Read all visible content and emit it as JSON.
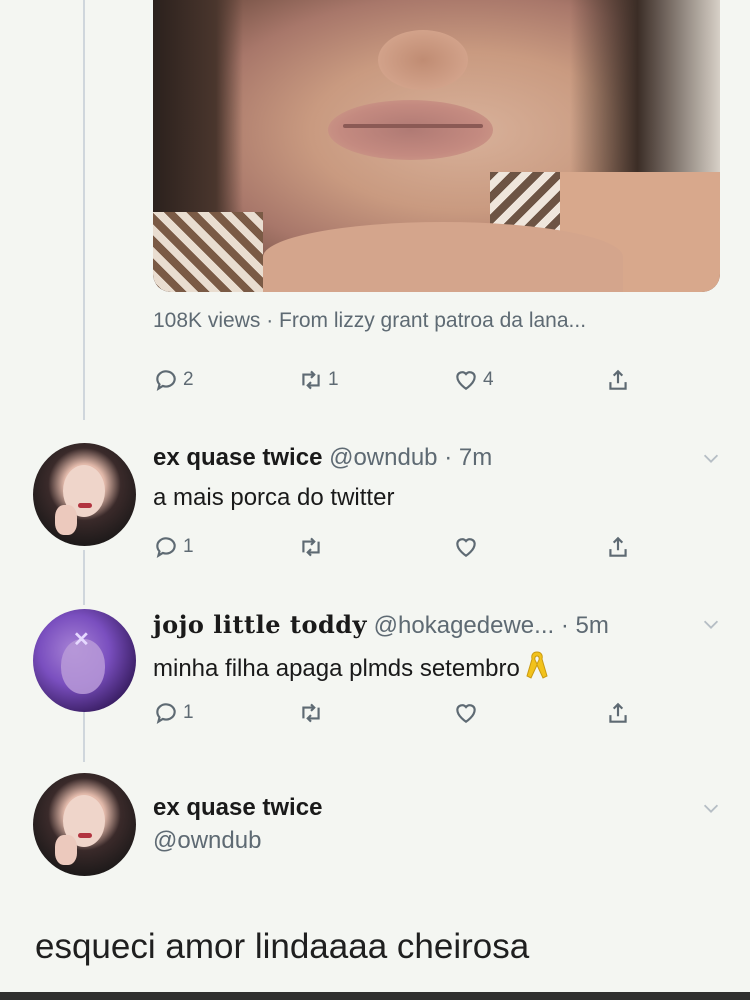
{
  "media_tweet": {
    "views_text": "108K views · From lizzy grant patroa da lana...",
    "actions": {
      "replies": "2",
      "retweets": "1",
      "likes": "4"
    }
  },
  "replies": [
    {
      "display_name": "ex quase twice",
      "handle": "@owndub",
      "time": "· 7m",
      "text": "a mais porca do twitter",
      "actions": {
        "replies": "1",
        "retweets": "",
        "likes": ""
      }
    },
    {
      "display_name": "jojo little toddy",
      "handle": "@hokagedewe...",
      "time": "· 5m",
      "text": "minha filha apaga plmds setembro",
      "actions": {
        "replies": "1",
        "retweets": "",
        "likes": ""
      }
    }
  ],
  "main_tweet": {
    "display_name": "ex quase twice",
    "handle": "@owndub",
    "text": "esqueci amor lindaaaa cheirosa"
  },
  "icons": {
    "reply": "reply-icon",
    "retweet": "retweet-icon",
    "like": "heart-icon",
    "share": "share-icon",
    "more": "chevron-down-icon",
    "ribbon": "yellow-ribbon-icon"
  },
  "colors": {
    "background": "#f4f6f2",
    "muted": "#5e6a73",
    "ribbon": "#f2c21b"
  }
}
